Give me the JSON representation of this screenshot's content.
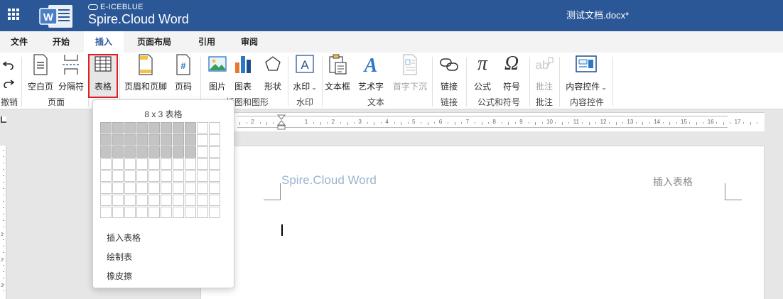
{
  "titlebar": {
    "brand_small": "E-ICEBLUE",
    "brand_big": "Spire.Cloud Word",
    "document_name": "测试文档.docx*",
    "logo_letter": "W"
  },
  "menu": {
    "tabs": [
      "文件",
      "开始",
      "插入",
      "页面布局",
      "引用",
      "审阅"
    ],
    "active_tab": "插入"
  },
  "ribbon": {
    "undo_label": "撤销",
    "groups": {
      "page": "页面",
      "illustrations": "插图和图形",
      "watermark": "水印",
      "text": "文本",
      "link": "链接",
      "formula": "公式和符号",
      "comment": "批注",
      "content_control": "内容控件"
    },
    "buttons": {
      "blank_page": "空白页",
      "separator": "分隔符",
      "table": "表格",
      "header_footer": "页眉和页脚",
      "page_number": "页码",
      "picture": "图片",
      "chart": "图表",
      "shape": "形状",
      "watermark": "水印",
      "textbox": "文本框",
      "wordart": "艺术字",
      "dropcap": "首字下沉",
      "link": "链接",
      "formula": "公式",
      "symbol": "符号",
      "comment": "批注",
      "content_control": "内容控件"
    },
    "glyphs": {
      "formula": "π",
      "symbol": "Ω",
      "wordart": "A",
      "watermark": "A",
      "page_number": "#"
    }
  },
  "table_dropdown": {
    "size_label": "8 x 3 表格",
    "columns": 10,
    "rows": 8,
    "selected_columns": 8,
    "selected_rows": 3,
    "items": [
      "插入表格",
      "绘制表",
      "橡皮擦"
    ]
  },
  "document": {
    "header_left": "Spire.Cloud Word",
    "header_right": "插入表格"
  },
  "ruler": {
    "numbers": [
      "1",
      "2",
      "1",
      "2",
      "3",
      "4",
      "5",
      "6",
      "7",
      "8",
      "9",
      "10",
      "11",
      "12",
      "13",
      "14",
      "15",
      "16",
      "17"
    ],
    "vertical_numbers": [
      "1",
      "2",
      "3"
    ]
  },
  "colors": {
    "title_bar": "#2b5797",
    "highlight_border": "#e51c23",
    "active_tab_text": "#2b5797",
    "header_text": "#9bb3cf"
  }
}
